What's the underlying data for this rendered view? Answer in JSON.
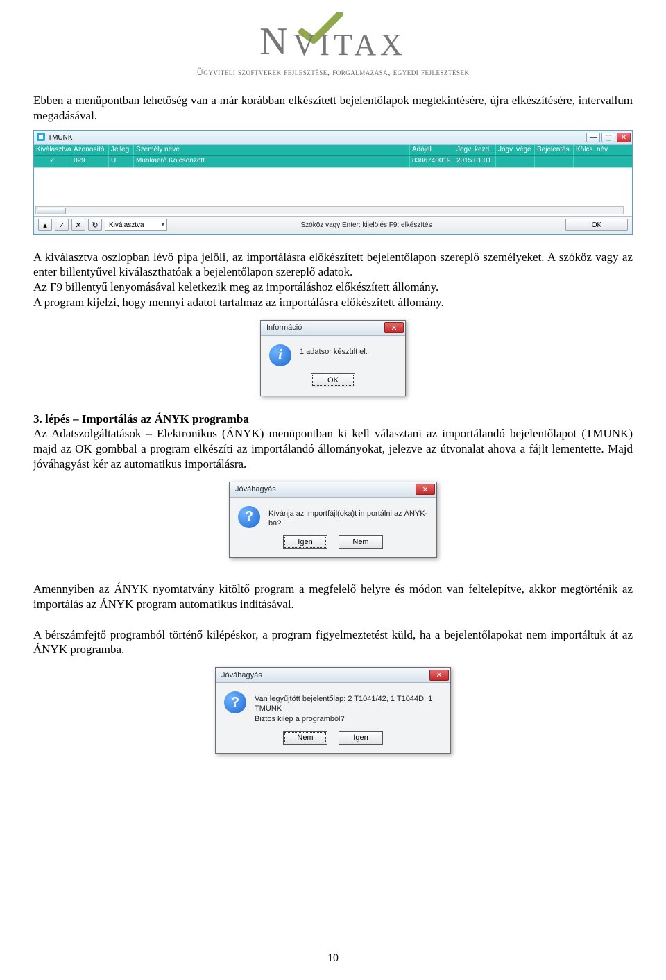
{
  "header": {
    "logo_name": "NOVITAX",
    "tagline": "Ügyviteli szoftverek fejlesztése, forgalmazása, egyedi fejlesztések"
  },
  "paragraphs": {
    "intro": "Ebben a menüpontban lehetőség van a már korábban elkészített bejelentőlapok megtekintésére, újra elkészítésére, intervallum megadásával.",
    "after_tmunk": "A kiválasztva oszlopban lévő pipa jelöli, az importálásra előkészített bejelentőlapon szereplő személyeket. A szóköz vagy az enter billentyűvel kiválaszthatóak a bejelentőlapon szereplő adatok.",
    "after_tmunk2": "Az F9 billentyű lenyomásával keletkezik meg az importáláshoz előkészített állomány.",
    "after_tmunk3": "A program kijelzi, hogy mennyi adatot tartalmaz az importálásra előkészített állomány.",
    "step3_head": "3. lépés – Importálás az ÁNYK programba",
    "step3_body": "Az Adatszolgáltatások – Elektronikus (ÁNYK) menüpontban ki kell választani az importálandó bejelentőlapot (TMUNK) majd az OK gombbal a program elkészíti az importálandó állományokat, jelezve az útvonalat ahova a fájlt lementette. Majd jóváhagyást kér az automatikus importálásra.",
    "p_anyk_after": "Amennyiben az ÁNYK nyomtatvány kitöltő program a megfelelő helyre és módon van feltelepítve, akkor megtörténik az importálás az ÁNYK program automatikus indításával.",
    "p_exit": "A bérszámfejtő programból történő kilépéskor, a program figyelmeztetést küld, ha a bejelentőlapokat nem importáltuk át az ÁNYK programba."
  },
  "tmunk": {
    "title": "TMUNK",
    "headers": [
      "Kiválasztva",
      "Azonosító",
      "Jelleg",
      "Személy neve",
      "Adójel",
      "Jogv. kezd.",
      "Jogv. vége",
      "Bejelentés",
      "Kölcs. név"
    ],
    "row": {
      "check": "✓",
      "azon": "029",
      "jelleg": "U",
      "nev": "Munkaerő Kölcsönzött",
      "adojel": "8386740019",
      "kezd": "2015.01.01",
      "vege": "",
      "bej": "",
      "kolcs": ""
    },
    "combo_value": "Kiválasztva",
    "hint": "Szóköz vagy Enter: kijelölés   F9: elkészítés",
    "ok": "OK"
  },
  "dlg_info": {
    "title": "Információ",
    "text": "1 adatsor készült el.",
    "ok": "OK"
  },
  "dlg_confirm": {
    "title": "Jóváhagyás",
    "text": "Kívánja az importfájl(oka)t importálni az ÁNYK-ba?",
    "yes": "Igen",
    "no": "Nem"
  },
  "dlg_exit": {
    "title": "Jóváhagyás",
    "line1": "Van legyűjtött bejelentőlap: 2 T1041/42, 1 T1044D, 1 TMUNK",
    "line2": "Biztos kilép a programból?",
    "no": "Nem",
    "yes": "Igen"
  },
  "page_number": "10"
}
